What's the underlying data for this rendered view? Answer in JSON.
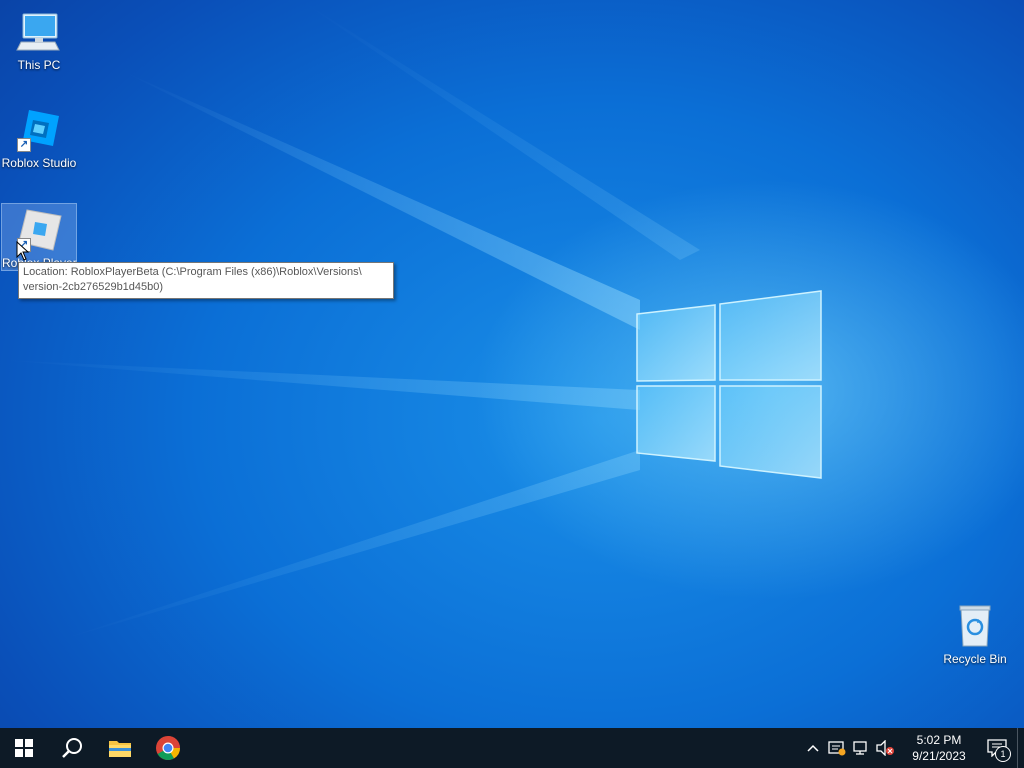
{
  "desktop": {
    "icons": [
      {
        "label": "This PC",
        "icon": "this-pc-icon"
      },
      {
        "label": "Roblox Studio",
        "icon": "roblox-studio-icon"
      },
      {
        "label": "Roblox Player",
        "icon": "roblox-player-icon"
      },
      {
        "label": "Recycle Bin",
        "icon": "recycle-bin-icon"
      }
    ],
    "tooltip": {
      "line1": "Location: RobloxPlayerBeta (C:\\Program Files (x86)\\Roblox\\Versions\\",
      "line2": "version-2cb276529b1d45b0)"
    }
  },
  "taskbar": {
    "pinned": [
      {
        "name": "start",
        "icon": "windows-logo-icon"
      },
      {
        "name": "search",
        "icon": "search-icon"
      },
      {
        "name": "file-explorer",
        "icon": "folder-icon"
      },
      {
        "name": "chrome",
        "icon": "chrome-icon"
      }
    ],
    "tray": {
      "icons": [
        "chevron-up-icon",
        "security-icon",
        "network-icon",
        "volume-muted-icon"
      ],
      "time": "5:02 PM",
      "date": "9/21/2023",
      "notification_count": "1"
    }
  },
  "colors": {
    "taskbar_bg": "#0d1a26",
    "wallpaper_accent": "#0b6fd6"
  }
}
